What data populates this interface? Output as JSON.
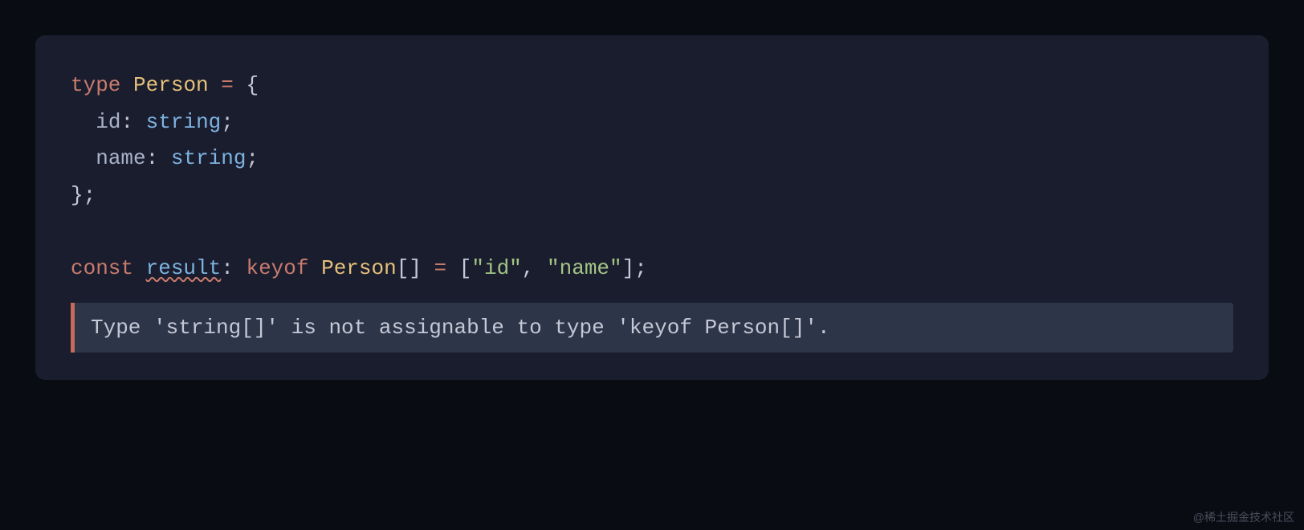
{
  "code": {
    "line1": {
      "kw_type": "type",
      "name": "Person",
      "eq": "=",
      "brace_open": "{"
    },
    "line2": {
      "prop": "id",
      "colon": ":",
      "type": "string",
      "semi": ";"
    },
    "line3": {
      "prop": "name",
      "colon": ":",
      "type": "string",
      "semi": ";"
    },
    "line4": {
      "brace_close": "};"
    },
    "line6": {
      "kw_const": "const",
      "varname": "result",
      "colon": ":",
      "kw_keyof": "keyof",
      "type": "Person",
      "brackets": "[]",
      "eq": "=",
      "bracket_open": "[",
      "str1": "\"id\"",
      "comma": ",",
      "str2": "\"name\"",
      "bracket_close": "];"
    }
  },
  "error": {
    "message": "Type 'string[]' is not assignable to type 'keyof Person[]'."
  },
  "watermark": "@稀土掘金技术社区"
}
